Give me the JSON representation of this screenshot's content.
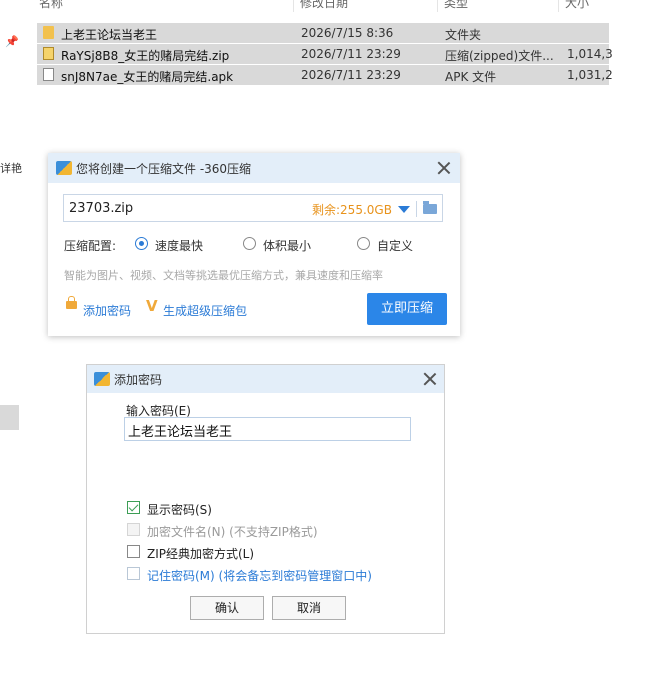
{
  "explorer": {
    "columns": {
      "name": "名称",
      "modified": "修改日期",
      "type": "类型",
      "size": "大小"
    },
    "edge_text": "详艳",
    "files": [
      {
        "name": "上老王论坛当老王",
        "modified": "2026/7/15 8:36",
        "type": "文件夹",
        "size": "",
        "icon": "folder-icon"
      },
      {
        "name": "RaYSj8B8_女王的赌局完结.zip",
        "modified": "2026/7/11 23:29",
        "type": "压缩(zipped)文件...",
        "size": "1,014,3",
        "icon": "zip-icon"
      },
      {
        "name": "snJ8N7ae_女王的赌局完结.apk",
        "modified": "2026/7/11 23:29",
        "type": "APK 文件",
        "size": "1,031,2",
        "icon": "apk-icon"
      }
    ]
  },
  "compress_dialog": {
    "title": "您将创建一个压缩文件 -360压缩",
    "filename": "23703.zip",
    "space_left": "剩余:255.0GB",
    "config_label": "压缩配置:",
    "options": [
      "速度最快",
      "体积最小",
      "自定义"
    ],
    "selected_option": "速度最快",
    "hint": "智能为图片、视频、文档等挑选最优压缩方式，兼具速度和压缩率",
    "add_password_link": "添加密码",
    "super_pack_link": "生成超级压缩包",
    "compress_button": "立即压缩",
    "accent_color": "#2b86e8"
  },
  "password_dialog": {
    "title": "添加密码",
    "input_label": "输入密码(E)",
    "password_value": "上老王论坛当老王",
    "checkboxes": [
      {
        "label": "显示密码(S)",
        "checked": true,
        "disabled": false
      },
      {
        "label": "加密文件名(N) (不支持ZIP格式)",
        "checked": false,
        "disabled": true
      },
      {
        "label": "ZIP经典加密方式(L)",
        "checked": false,
        "disabled": false
      },
      {
        "label": "记住密码(M) (将会备忘到密码管理窗口中)",
        "checked": false,
        "disabled": false
      }
    ],
    "ok_button": "确认",
    "cancel_button": "取消"
  }
}
